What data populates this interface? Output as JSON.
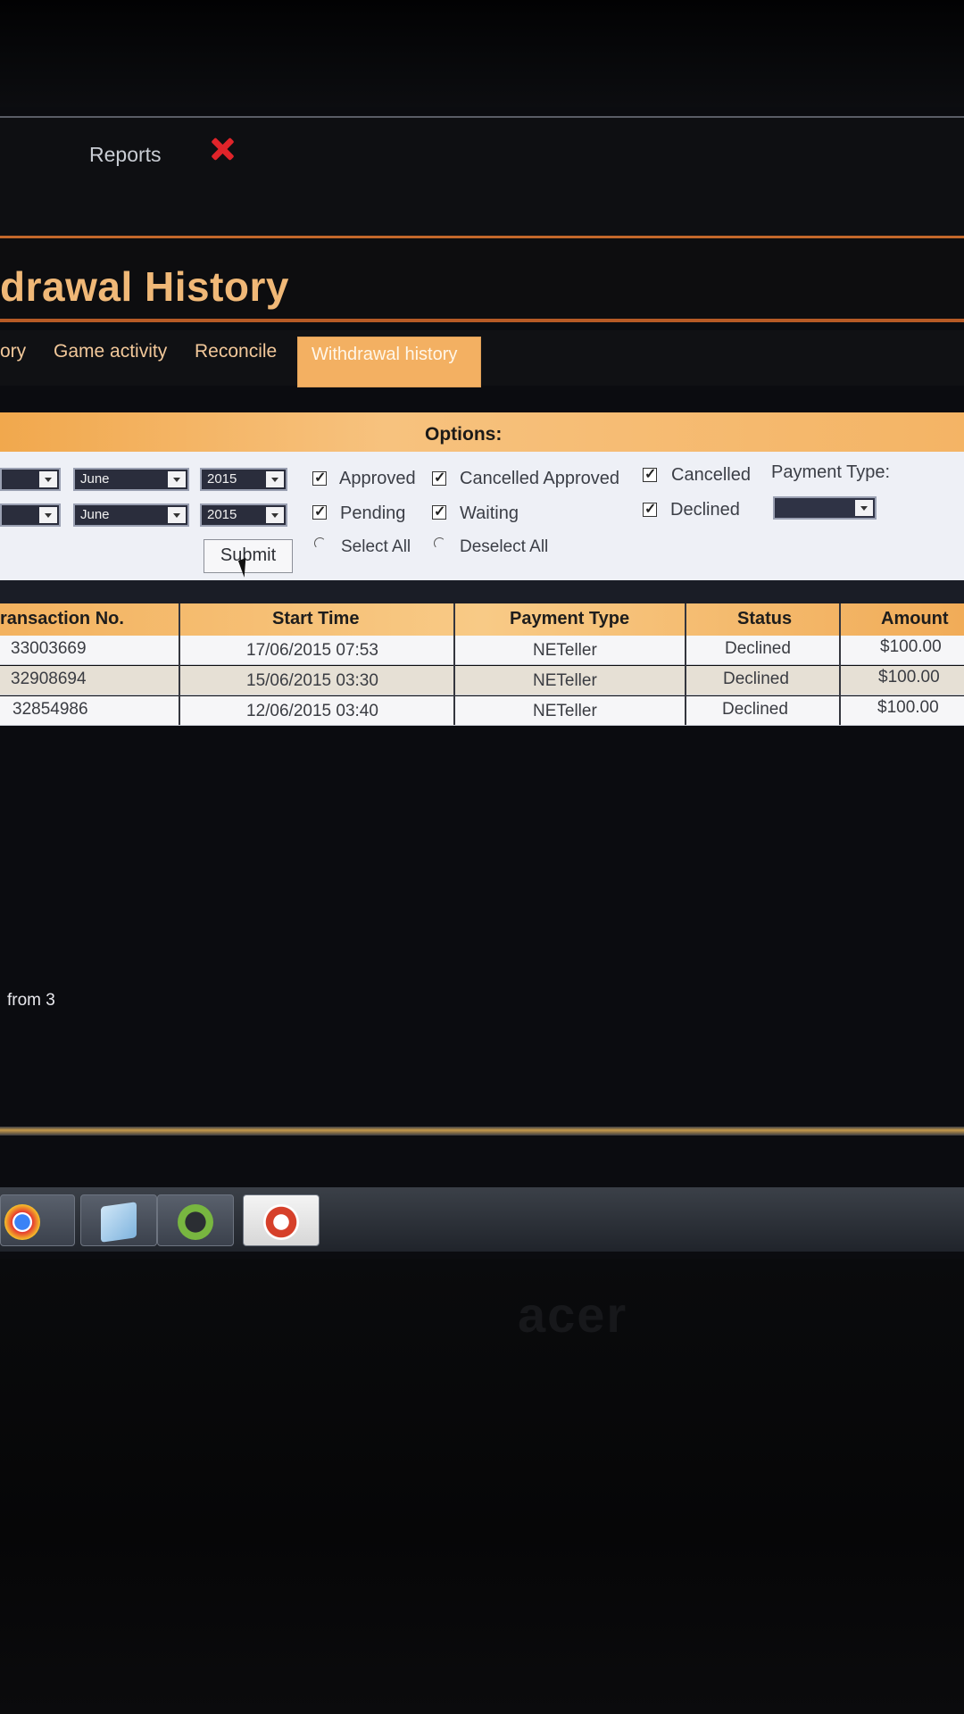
{
  "window": {
    "menu": {
      "reports_label": "Reports"
    },
    "page_title": "drawal History"
  },
  "tabs": [
    {
      "label": "ory",
      "active": false
    },
    {
      "label": "Game activity",
      "active": false
    },
    {
      "label": "Reconcile",
      "active": false
    },
    {
      "label": "Withdrawal history",
      "active": true
    }
  ],
  "options": {
    "title": "Options:",
    "from": {
      "month": "June",
      "year": "2015"
    },
    "to": {
      "month": "June",
      "year": "2015"
    },
    "checkboxes": {
      "approved": {
        "label": "Approved",
        "checked": true
      },
      "cancelled_approved": {
        "label": "Cancelled Approved",
        "checked": true
      },
      "cancelled": {
        "label": "Cancelled",
        "checked": true
      },
      "pending": {
        "label": "Pending",
        "checked": true
      },
      "waiting": {
        "label": "Waiting",
        "checked": true
      },
      "declined": {
        "label": "Declined",
        "checked": true
      }
    },
    "select_all_label": "Select All",
    "deselect_all_label": "Deselect All",
    "payment_type_label": "Payment Type:",
    "payment_type_value": "",
    "submit_label": "Submit"
  },
  "table": {
    "columns": [
      "ransaction No.",
      "Start Time",
      "Payment Type",
      "Status",
      "Amount"
    ],
    "rows": [
      [
        "33003669",
        "17/06/2015 07:53",
        "NETeller",
        "Declined",
        "$100.00"
      ],
      [
        "32908694",
        "15/06/2015 03:30",
        "NETeller",
        "Declined",
        "$100.00"
      ],
      [
        "32854986",
        "12/06/2015 03:40",
        "NETeller",
        "Declined",
        "$100.00"
      ]
    ]
  },
  "pager": {
    "text": "from  3"
  },
  "colors": {
    "accent": "#f3b062",
    "title": "#f0b877",
    "close": "#e0242a"
  }
}
